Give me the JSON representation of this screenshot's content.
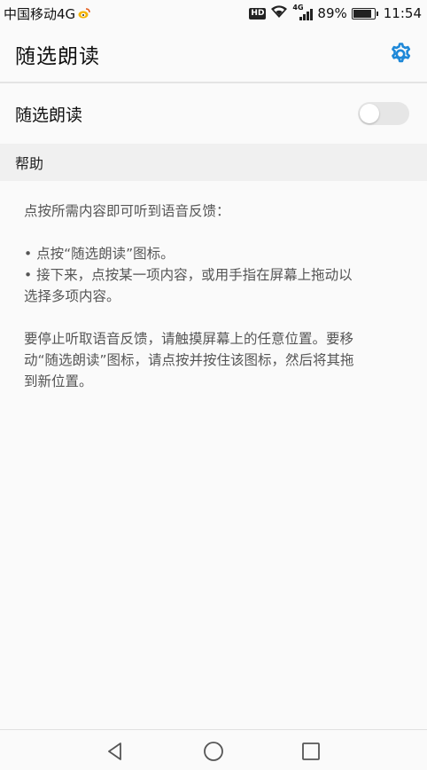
{
  "status_bar": {
    "carrier": "中国移动4G",
    "hd": "HD",
    "network": "4G",
    "battery_percent": "89%",
    "battery_level": 0.89,
    "time": "11:54"
  },
  "app_bar": {
    "title": "随选朗读",
    "settings_icon": "gear-icon",
    "accent_color": "#1e88d8"
  },
  "toggle": {
    "label": "随选朗读",
    "state": "off"
  },
  "help": {
    "header": "帮助",
    "intro": "点按所需内容即可听到语音反馈：",
    "bullet1": "• 点按“随选朗读”图标。",
    "bullet2_line1": "• 接下来，点按某一项内容，或用手指在屏幕上拖动以",
    "bullet2_line2": "选择多项内容。",
    "para_line1": "要停止听取语音反馈，请触摸屏幕上的任意位置。要移",
    "para_line2": "动“随选朗读”图标，请点按并按住该图标，然后将其拖",
    "para_line3": "到新位置。"
  },
  "nav_bar": {
    "back_icon": "back-triangle-icon",
    "home_icon": "home-circle-icon",
    "recents_icon": "recents-square-icon"
  }
}
